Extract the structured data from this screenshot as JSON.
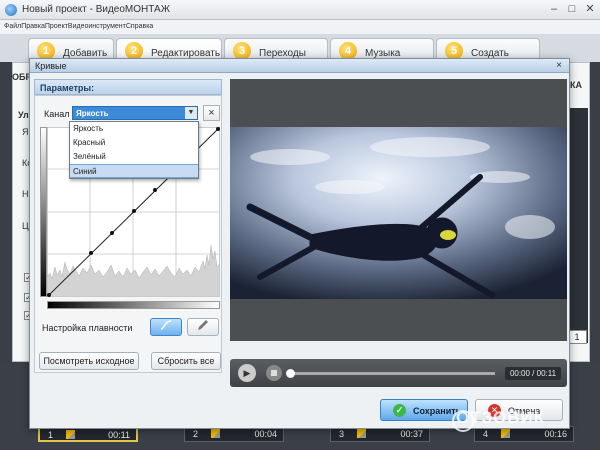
{
  "app": {
    "title": "Новый проект - ВидеоМОНТАЖ",
    "menu": "ФайлПравкаПроектВидеоинструментСправка",
    "steps": [
      {
        "num": "1",
        "label": "Добавить"
      },
      {
        "num": "2",
        "label": "Редактировать"
      },
      {
        "num": "3",
        "label": "Переходы"
      },
      {
        "num": "4",
        "label": "Музыка"
      },
      {
        "num": "5",
        "label": "Создать"
      }
    ],
    "bg_left_tab": "ОБР",
    "bg_right_tab": "КА",
    "bg_fragments": [
      "Ул",
      "Яр",
      "Ко",
      "На",
      "Цв"
    ],
    "bg_mini_button": "1",
    "timeline": [
      {
        "num": "1",
        "time": "00:11"
      },
      {
        "num": "2",
        "time": "00:04"
      },
      {
        "num": "3",
        "time": "00:37"
      },
      {
        "num": "4",
        "time": "00:16"
      }
    ],
    "watermark": "ОТЗОВИК"
  },
  "dialog": {
    "title": "Кривые",
    "close_glyph": "×",
    "params_header": "Параметры:",
    "channel_label": "Канал",
    "channel_selected": "Яркость",
    "channel_options": [
      "Яркость",
      "Красный",
      "Зелёный",
      "Синий"
    ],
    "channel_highlighted_index": 3,
    "reset_glyph": "×",
    "smoothness_label": "Настройка плавности",
    "view_original_button": "Посмотреть исходное",
    "reset_all_button": "Сбросить все",
    "player": {
      "time": "00:00 / 00:11",
      "progress": 0.0
    },
    "save_button": "Сохранить",
    "cancel_button": "Отмена"
  },
  "colors": {
    "accent": "#3d8ad8",
    "save_icon": "#3bb84a",
    "cancel_icon": "#d9342b"
  }
}
